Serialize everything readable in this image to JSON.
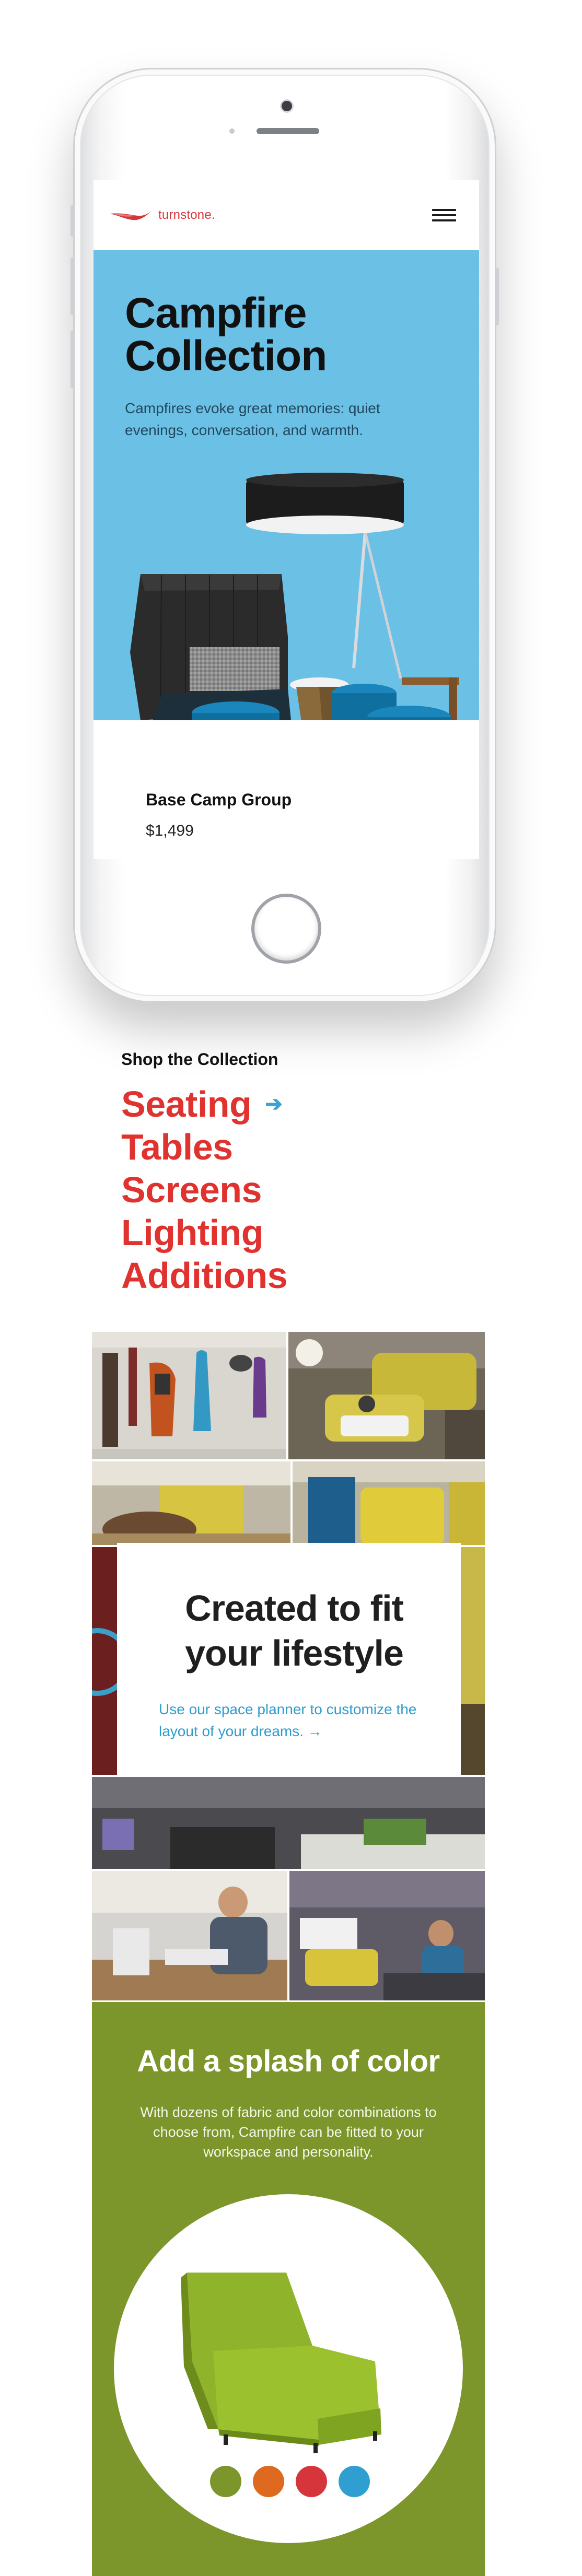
{
  "brand": {
    "name": "turnstone.",
    "accent": "#d6353b"
  },
  "nav": {
    "menu_icon": "hamburger-menu-icon"
  },
  "hero": {
    "title": "Campfire Collection",
    "subtitle": "Campfires evoke great memories: quiet evenings, conversation, and warmth.",
    "background": "#6bc0e6"
  },
  "product": {
    "name": "Base Camp Group",
    "price": "$1,499"
  },
  "shop": {
    "heading": "Shop the Collection",
    "items": [
      {
        "label": "Seating",
        "active": true
      },
      {
        "label": "Tables"
      },
      {
        "label": "Screens"
      },
      {
        "label": "Lighting"
      },
      {
        "label": "Additions"
      }
    ],
    "arrow_icon": "arrow-right-icon",
    "link_color": "#e0322e"
  },
  "planner": {
    "title": "Created to fit your lifestyle",
    "link": "Use our space planner to customize the layout of your dreams. →"
  },
  "splash": {
    "title": "Add a splash of color",
    "body": "With dozens of fabric and color combinations to choose from, Campfire can be fitted to your workspace and personality.",
    "background": "#7c962b",
    "swatches": [
      "#7c962b",
      "#dd6a1f",
      "#d6353b",
      "#2f9fd1"
    ]
  }
}
